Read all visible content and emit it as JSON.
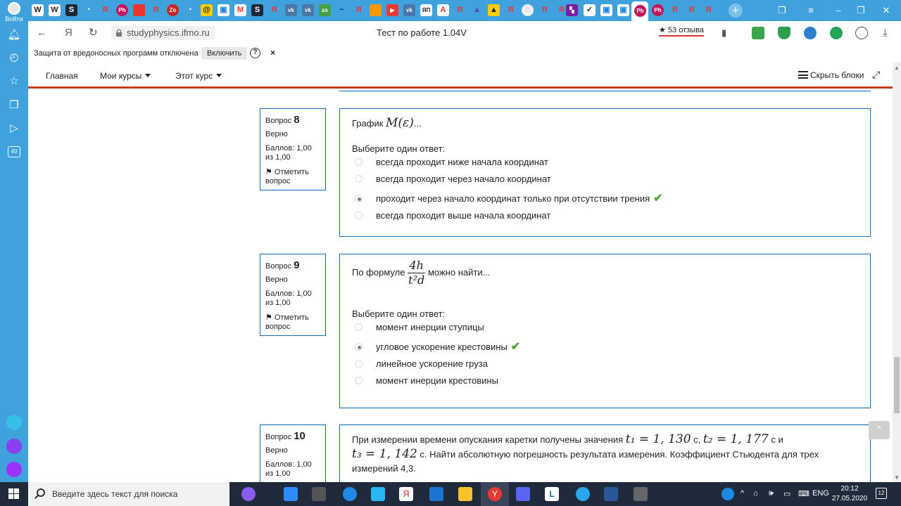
{
  "browser": {
    "login_label": "Войти",
    "sidebar_badge": "40",
    "page_title": "Тест по работе 1.04V",
    "url": "studyphysics.ifmo.ru",
    "reviews": "★ 53 отзыва",
    "back_label": "←",
    "yandex_label": "Я",
    "reload_label": "↻"
  },
  "notification": {
    "text": "Защита от вредоносных программ отключена",
    "enable_label": "Включить",
    "help_label": "?",
    "close_label": "×"
  },
  "site_nav": {
    "home": "Главная",
    "my_courses": "Мои курсы",
    "this_course": "Этот курс",
    "hide_blocks": "Скрыть блоки"
  },
  "questions": [
    {
      "label": "Вопрос",
      "number": "8",
      "status": "Верно",
      "grade": "Баллов: 1,00 из 1,00",
      "flag": "Отметить вопрос",
      "text_before": "График",
      "math": "M(ε)",
      "text_after": "...",
      "prompt": "Выберите один ответ:",
      "options": [
        {
          "text": "всегда проходит ниже начала координат",
          "selected": false
        },
        {
          "text": "всегда проходит через начало координат",
          "selected": false
        },
        {
          "text": "проходит через начало координат только при отсутствии трения",
          "selected": true
        },
        {
          "text": "всегда проходит выше начала координат",
          "selected": false
        }
      ]
    },
    {
      "label": "Вопрос",
      "number": "9",
      "status": "Верно",
      "grade": "Баллов: 1,00 из 1,00",
      "flag": "Отметить вопрос",
      "text_before": "По формуле",
      "frac_num": "4h",
      "frac_den": "t²d",
      "text_after": "можно найти...",
      "prompt": "Выберите один ответ:",
      "options": [
        {
          "text": "момент инерции ступицы",
          "selected": false
        },
        {
          "text": "угловое ускорение крестовины",
          "selected": true
        },
        {
          "text": "линейное ускорение груза",
          "selected": false
        },
        {
          "text": "момент инерции крестовины",
          "selected": false
        }
      ]
    },
    {
      "label": "Вопрос",
      "number": "10",
      "status": "Верно",
      "grade": "Баллов: 1,00 из 1,00",
      "t1_text": "При измерении времени опускания каретки получены значения",
      "t1": "t₁ = 1, 130",
      "unit1": "с,",
      "t2": "t₂ = 1, 177",
      "unit2": "с и",
      "t3": "t₃ = 1, 142",
      "unit3": "с. Найти абсолютную погрешность результата измерения. Коэффициент Стьюдента для трех измерений 4,3."
    }
  ],
  "taskbar": {
    "search_placeholder": "Введите здесь текст для поиска",
    "lang": "ENG",
    "time": "20:12",
    "date": "27.05.2020",
    "notif_count": "12"
  },
  "colors": {
    "browser_blue": "#3fa2dc",
    "nav_accent": "#c93b1b",
    "question_border": "#0f6cbf",
    "check_green": "#5ba13a"
  }
}
